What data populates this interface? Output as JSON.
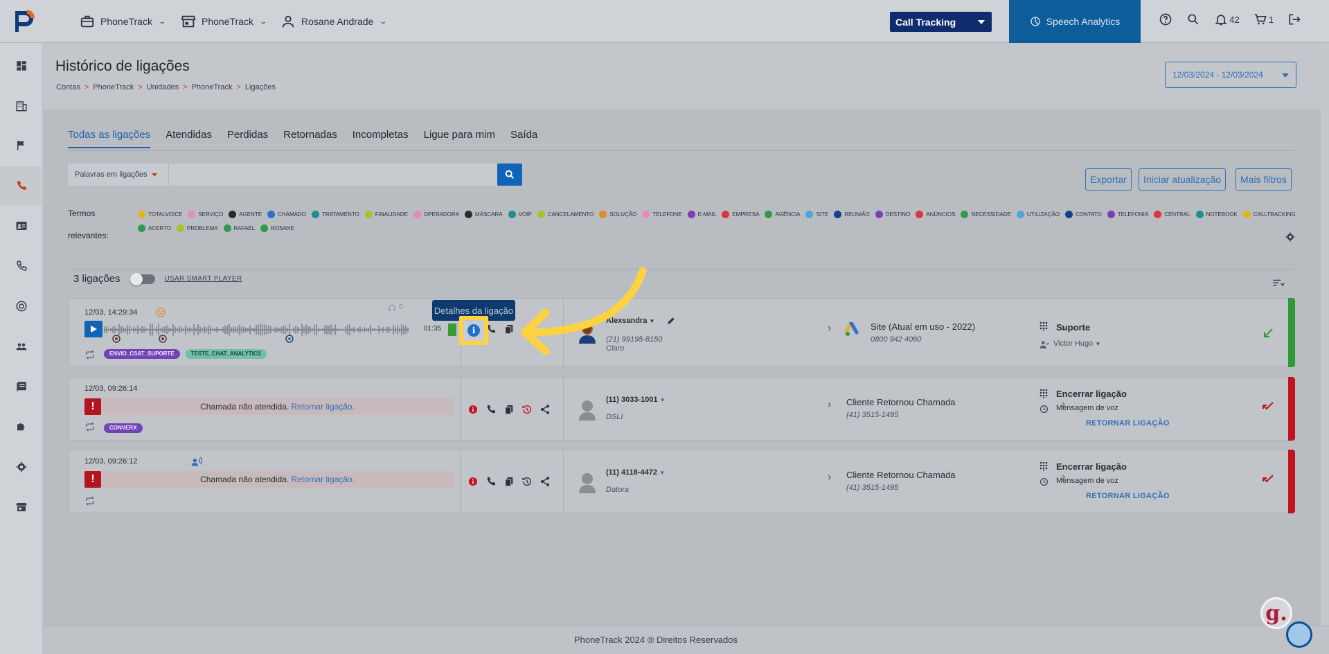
{
  "topbar": {
    "menu1": "PhoneTrack",
    "menu2": "PhoneTrack",
    "user": "Rosane Andrade",
    "product_select": "Call Tracking",
    "speech": "Speech Analytics",
    "notifications": "42",
    "cart": "1"
  },
  "page": {
    "title": "Histórico de ligações",
    "breadcrumb": [
      "Contas",
      "PhoneTrack",
      "Unidades",
      "PhoneTrack",
      "Ligações"
    ],
    "date_range": "12/03/2024 - 12/03/2024"
  },
  "tabs": [
    "Todas as ligações",
    "Atendidas",
    "Perdidas",
    "Retornadas",
    "Incompletas",
    "Ligue para mim",
    "Saída"
  ],
  "search": {
    "select_label": "Palavras em ligações",
    "placeholder": ""
  },
  "buttons": {
    "export": "Exportar",
    "refresh": "Iniciar atualização",
    "filters": "Mais filtros"
  },
  "terms": {
    "label_line1": "Termos",
    "label_line2": "relevantes:",
    "items": [
      {
        "label": "totalvoice",
        "color": "#e2b41f"
      },
      {
        "label": "serviço",
        "color": "#e88bb4"
      },
      {
        "label": "agente",
        "color": "#2b2b2b"
      },
      {
        "label": "chamado",
        "color": "#2e6fd1"
      },
      {
        "label": "tratamento",
        "color": "#1e8f8f"
      },
      {
        "label": "finalidade",
        "color": "#a7c22a"
      },
      {
        "label": "operadora",
        "color": "#e88bb4"
      },
      {
        "label": "máscara",
        "color": "#2b2b2b"
      },
      {
        "label": "voip",
        "color": "#1e8f8f"
      },
      {
        "label": "cancelamento",
        "color": "#a7c22a"
      },
      {
        "label": "solução",
        "color": "#e38a2a"
      },
      {
        "label": "telefone",
        "color": "#e88bb4"
      },
      {
        "label": "e-mail",
        "color": "#7b3fb8"
      },
      {
        "label": "empresa",
        "color": "#d9363e"
      },
      {
        "label": "agência",
        "color": "#2e9a4a"
      },
      {
        "label": "site",
        "color": "#4aa7d8"
      },
      {
        "label": "reunião",
        "color": "#13418c"
      },
      {
        "label": "destino",
        "color": "#7b3fb8"
      },
      {
        "label": "anúncios",
        "color": "#d9363e"
      },
      {
        "label": "necessidade",
        "color": "#2e9a4a"
      },
      {
        "label": "utilização",
        "color": "#4aa7d8"
      },
      {
        "label": "contato",
        "color": "#13418c"
      },
      {
        "label": "telefonia",
        "color": "#7b3fb8"
      },
      {
        "label": "central",
        "color": "#d9363e"
      },
      {
        "label": "notebook",
        "color": "#1e8f8f"
      },
      {
        "label": "calltracking",
        "color": "#e2b41f"
      },
      {
        "label": "acerto",
        "color": "#2e9a4a"
      },
      {
        "label": "problema",
        "color": "#a7c22a"
      },
      {
        "label": "rafael",
        "color": "#2e9a4a"
      },
      {
        "label": "rosane",
        "color": "#2e9a4a"
      }
    ]
  },
  "list": {
    "count": "3 ligações",
    "smart_player": "USAR SMART PLAYER"
  },
  "tooltip": "Detalhes da ligação",
  "calls": [
    {
      "datetime": "12/03, 14:29:34",
      "duration": "01:35",
      "listen_count": "0",
      "tags": [
        "ENVIO_CSAT_SUPORTE",
        "TESTE_CHAT_ANALYTICS"
      ],
      "contact": "Alexsandra",
      "phone": "(21) 99195-8150",
      "carrier": "Claro",
      "source": "Site (Atual em uso - 2022)",
      "source_phone": "0800 942 4060",
      "destination": "Suporte",
      "agent": "Victor Hugo"
    },
    {
      "datetime": "12/03, 09:26:14",
      "message": "Chamada não atendida.",
      "return_link": "Retornar ligação.",
      "tags": [
        "CONVERX"
      ],
      "contact": "(11) 3033-1001",
      "carrier": "DSLI",
      "source": "Cliente Retornou Chamada",
      "source_phone": "(41) 3515-1495",
      "destination": "Encerrar ligação",
      "dest_detail": "Mensagem de voz",
      "return_action": "RETORNAR LIGAÇÃO"
    },
    {
      "datetime": "12/03, 09:26:12",
      "message": "Chamada não atendida.",
      "return_link": "Retornar ligação.",
      "contact": "(11) 4118-4472",
      "carrier": "Datora",
      "source": "Cliente Retornou Chamada",
      "source_phone": "(41) 3515-1495",
      "destination": "Encerrar ligação",
      "dest_detail": "Mensagem de voz",
      "return_action": "RETORNAR LIGAÇÃO"
    }
  ],
  "footer": "PhoneTrack 2024 ® Direitos Reservados",
  "colors": {
    "primary": "#0f64b8",
    "accent_arrow": "#ffd23f",
    "answered": "#2e9a3a",
    "missed": "#c0131f"
  }
}
